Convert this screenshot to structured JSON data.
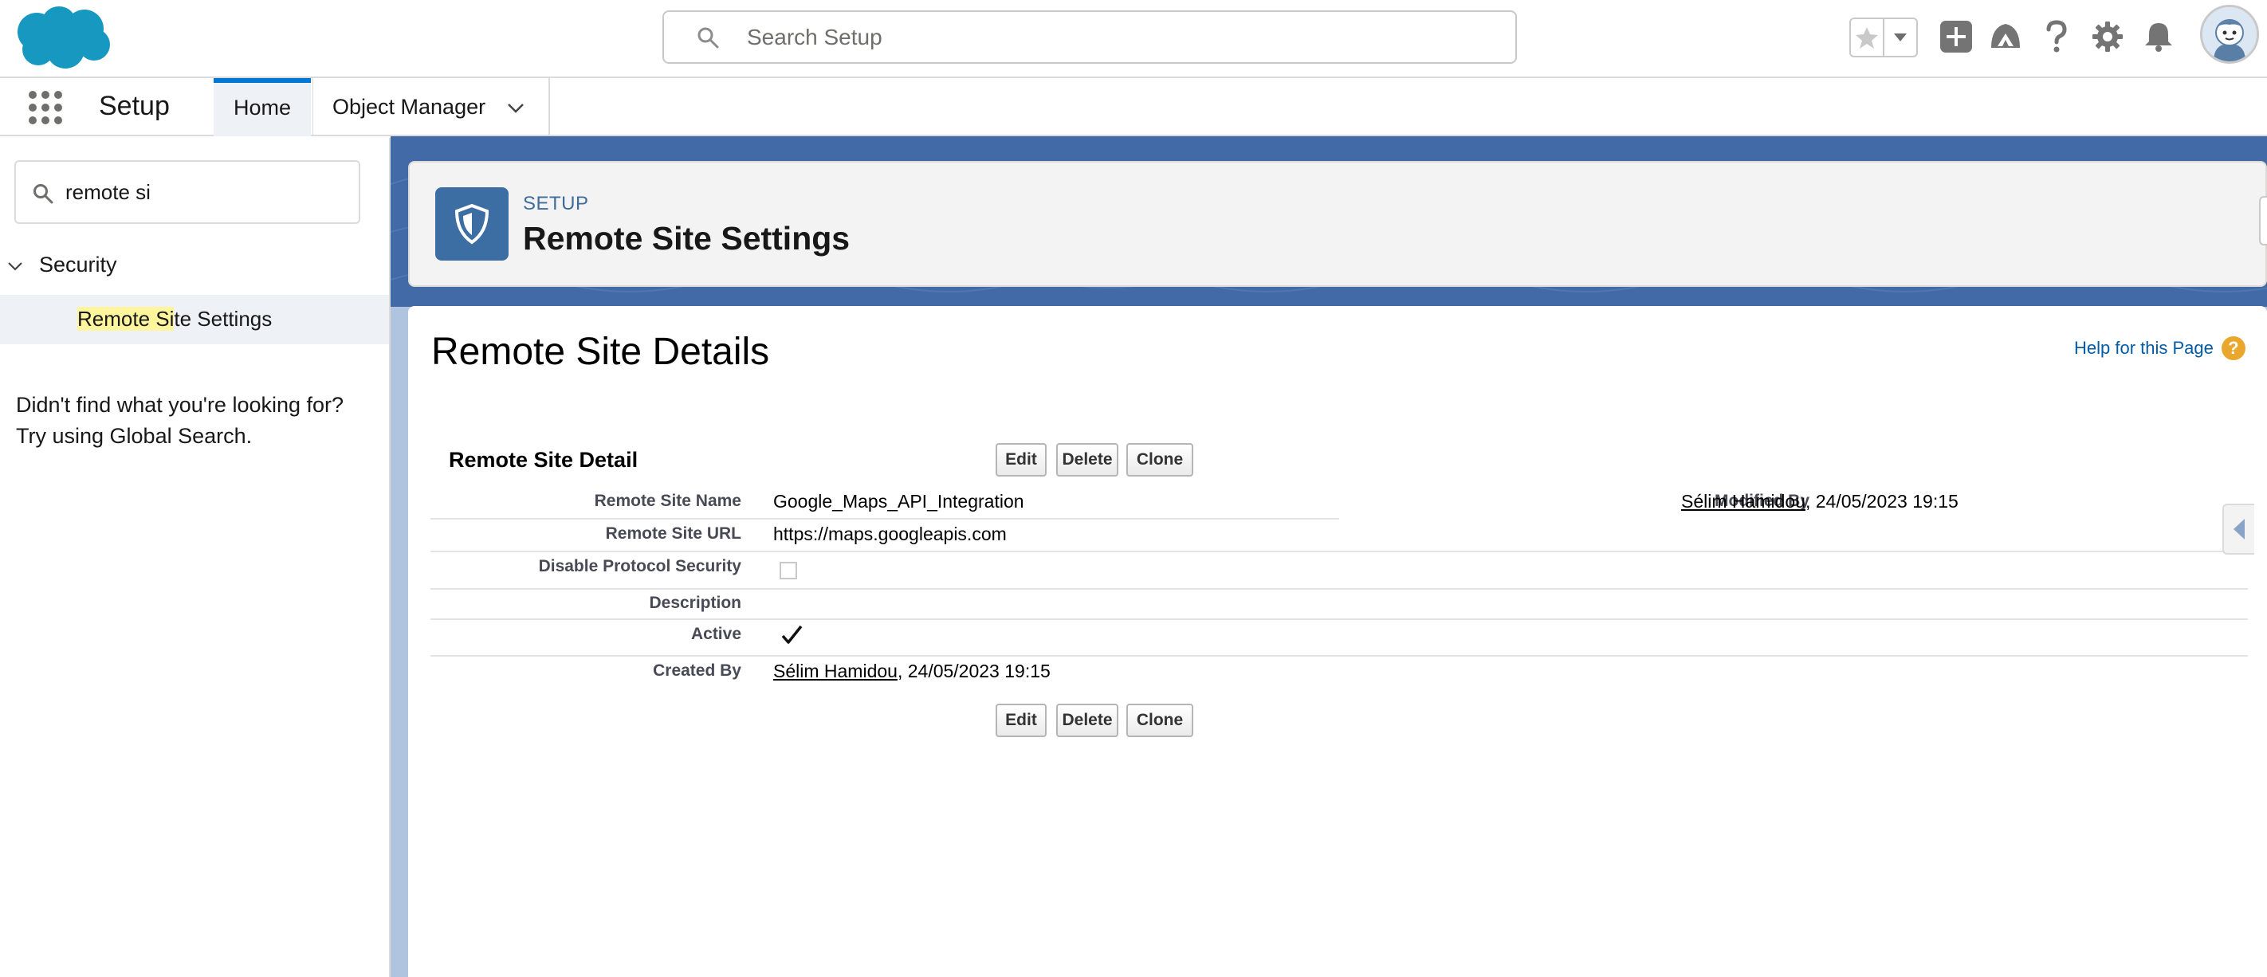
{
  "header": {
    "search_placeholder": "Search Setup"
  },
  "nav": {
    "app_name": "Setup",
    "tabs": [
      {
        "label": "Home",
        "active": true
      },
      {
        "label": "Object Manager"
      }
    ]
  },
  "sidebar": {
    "quickfind_value": "remote si",
    "group_label": "Security",
    "leaf_label_highlight": "Remote Si",
    "leaf_label_rest": "te Settings",
    "no_results_line1": "Didn't find what you're looking for?",
    "no_results_line2": "Try using Global Search."
  },
  "page_header": {
    "eyebrow": "SETUP",
    "title": "Remote Site Settings"
  },
  "content": {
    "heading": "Remote Site Details",
    "help_link": "Help for this Page",
    "section_title": "Remote Site Detail",
    "buttons": {
      "edit": "Edit",
      "delete": "Delete",
      "clone": "Clone"
    },
    "fields": {
      "remote_site_name_label": "Remote Site Name",
      "remote_site_name_value": "Google_Maps_API_Integration",
      "remote_site_url_label": "Remote Site URL",
      "remote_site_url_value": "https://maps.googleapis.com",
      "disable_protocol_label": "Disable Protocol Security",
      "disable_protocol_checked": false,
      "description_label": "Description",
      "active_label": "Active",
      "active_checked": true,
      "created_by_label": "Created By",
      "created_by_user": "Sélim Hamidou",
      "created_by_date": ", 24/05/2023 19:15",
      "modified_by_label": "Modified By",
      "modified_by_user": "Sélim Hamidou",
      "modified_by_date": ", 24/05/2023 19:15"
    }
  },
  "colors": {
    "brand_blue": "#0176d3",
    "band_blue": "#426aa6",
    "badge_blue": "#3c6ea3",
    "help_orange": "#e9a72d",
    "highlight_yellow": "#fff59d"
  },
  "icons": [
    "salesforce-cloud-logo",
    "search-icon",
    "star-icon",
    "caret-down-icon",
    "add-icon",
    "trailhead-icon",
    "help-icon",
    "gear-icon",
    "bell-icon",
    "avatar",
    "app-launcher-icon",
    "chevron-down-icon",
    "shield-icon",
    "checkmark-icon"
  ]
}
